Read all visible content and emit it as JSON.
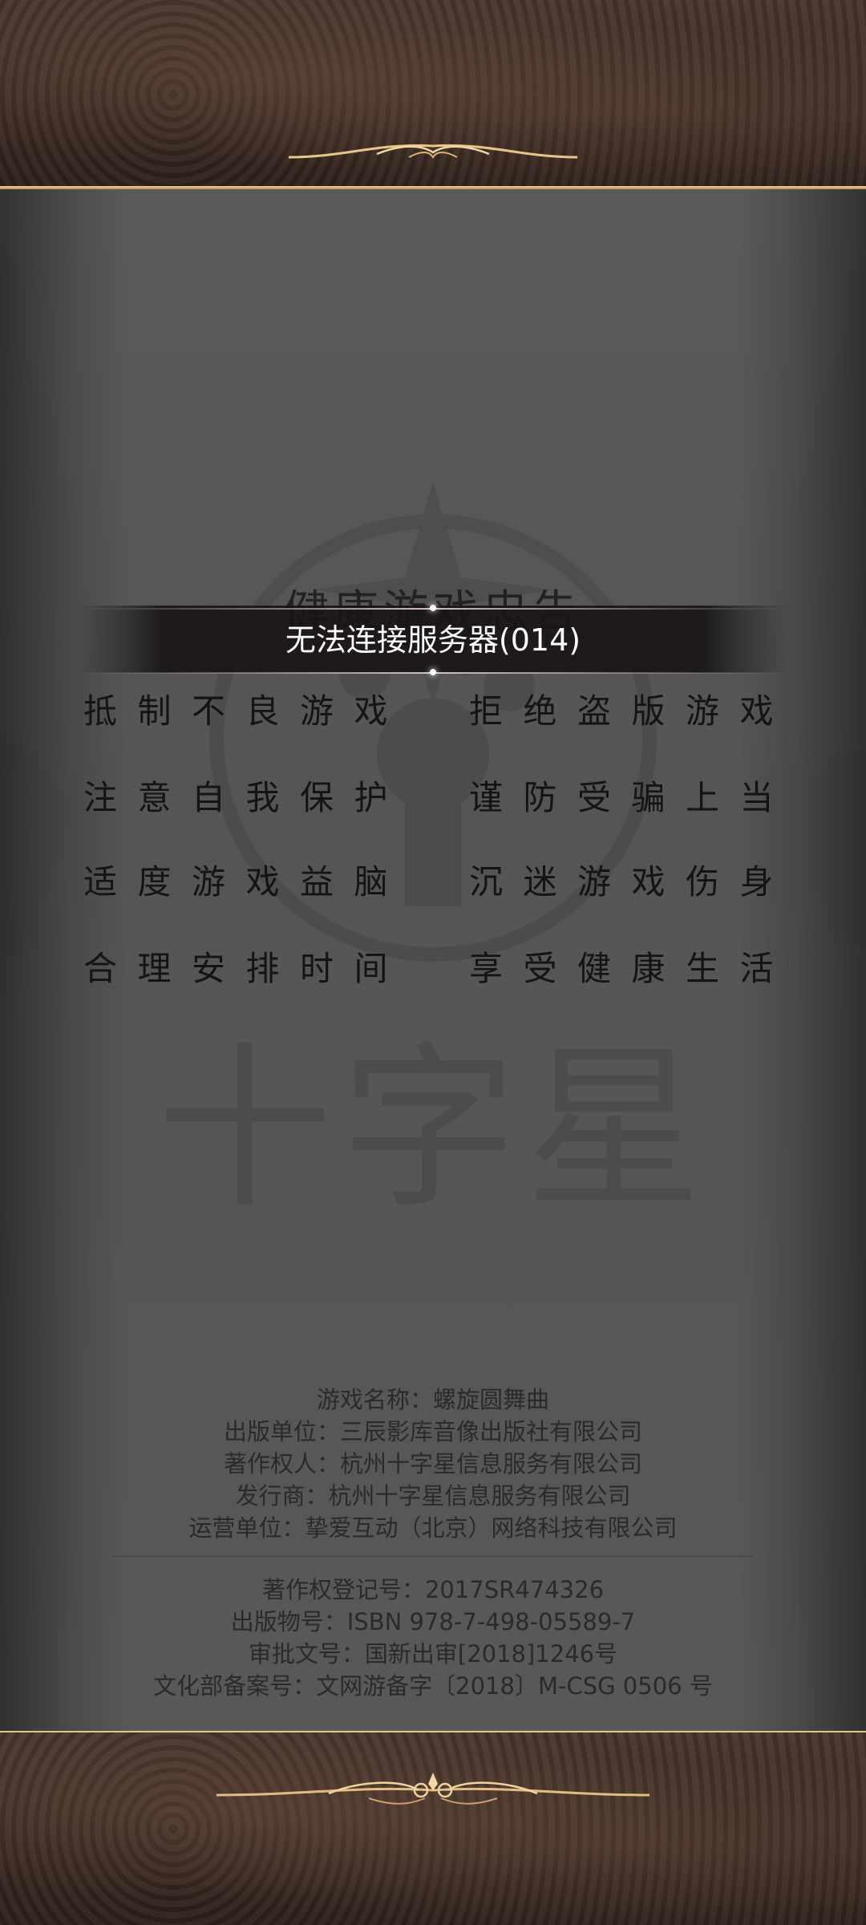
{
  "error": {
    "message": "无法连接服务器(014)"
  },
  "notice": {
    "title": "健康游戏忠告",
    "rows": [
      {
        "left": "抵制不良游戏",
        "right": "拒绝盗版游戏"
      },
      {
        "left": "注意自我保护",
        "right": "谨防受骗上当"
      },
      {
        "left": "适度游戏益脑",
        "right": "沉迷游戏伤身"
      },
      {
        "left": "合理安排时间",
        "right": "享受健康生活"
      }
    ]
  },
  "watermark": {
    "text": "十字星"
  },
  "credits": {
    "game_name": "游戏名称：螺旋圆舞曲",
    "publisher": "出版单位：三辰影库音像出版社有限公司",
    "copyright_owner": "著作权人：杭州十字星信息服务有限公司",
    "distributor": "发行商：杭州十字星信息服务有限公司",
    "operator": "运营单位：挚爱互动（北京）网络科技有限公司",
    "copyright_reg": "著作权登记号：2017SR474326",
    "isbn": "出版物号：ISBN 978-7-498-05589-7",
    "approval": "审批文号：国新出审[2018]1246号",
    "culture_filing": "文化部备案号：文网游备字〔2018〕M-CSG 0506 号"
  },
  "colors": {
    "gold": "#c9a068",
    "panel": "#575757",
    "leather": "#3b2a22"
  }
}
